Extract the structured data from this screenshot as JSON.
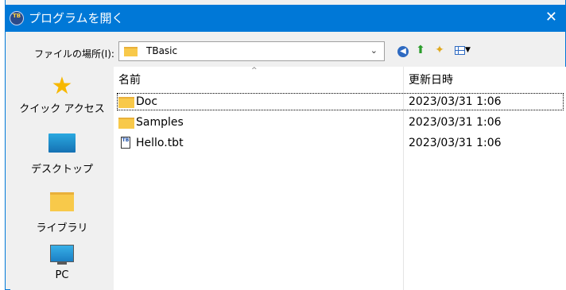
{
  "window": {
    "title": "プログラムを開く",
    "close_glyph": "✕",
    "app_icon_text": "TB"
  },
  "toolbar": {
    "lookin_label": "ファイルの場所(I):",
    "lookin_value": "TBasic",
    "dropdown_glyph": "⌄"
  },
  "places": [
    {
      "label": "クイック アクセス"
    },
    {
      "label": "デスクトップ"
    },
    {
      "label": "ライブラリ"
    },
    {
      "label": "PC"
    }
  ],
  "columns": {
    "name": "名前",
    "date": "更新日時",
    "sort_glyph": "^"
  },
  "files": [
    {
      "name": "Doc",
      "date": "2023/03/31 1:06",
      "type": "folder"
    },
    {
      "name": "Samples",
      "date": "2023/03/31 1:06",
      "type": "folder"
    },
    {
      "name": "Hello.tbt",
      "date": "2023/03/31 1:06",
      "type": "file"
    }
  ],
  "icons": {
    "back": "arrow-left-icon",
    "up": "folder-up-icon",
    "new_folder": "new-folder-icon",
    "view": "view-menu-icon"
  },
  "colors": {
    "titlebar": "#0078d7",
    "folder": "#f8c94a"
  }
}
